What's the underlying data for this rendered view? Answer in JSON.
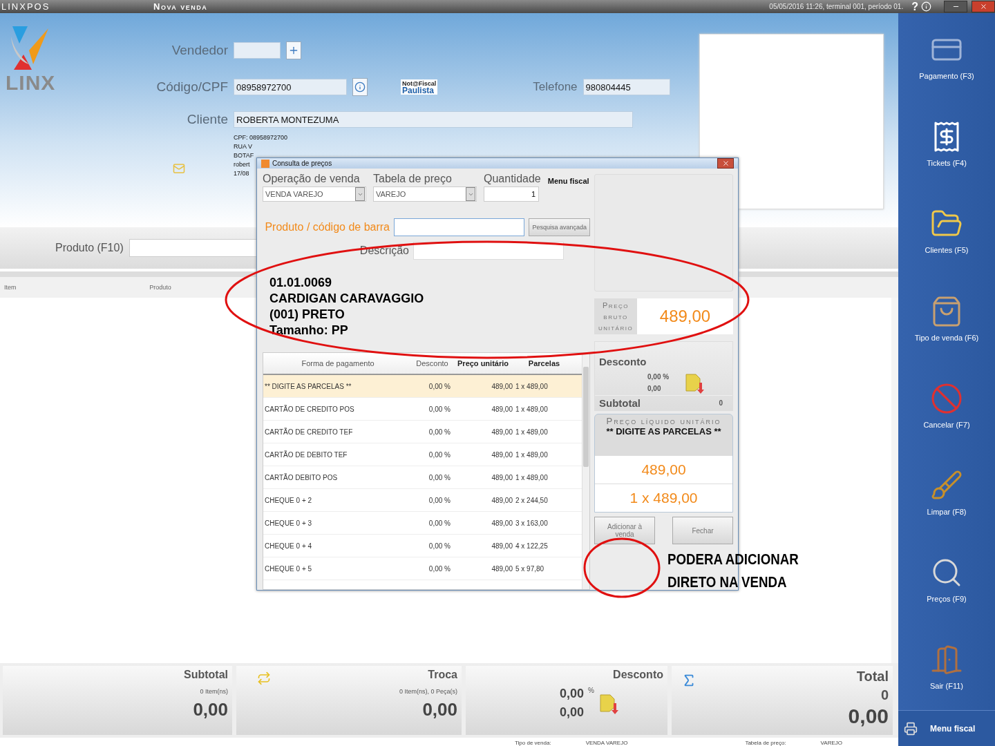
{
  "titlebar": {
    "app": "LINXPOS",
    "title": "Nova venda",
    "status": "05/05/2016 11:26, terminal 001, período 01.",
    "help": "?"
  },
  "logo": {
    "text": "LINX"
  },
  "form": {
    "vendedor": {
      "label": "Vendedor"
    },
    "cpf": {
      "label": "Código/CPF",
      "value": "08958972700"
    },
    "nota_badge": [
      "Not@Fiscal",
      "Paulista"
    ],
    "telefone": {
      "label": "Telefone",
      "value": "980804445"
    },
    "cliente": {
      "label": "Cliente",
      "value": "ROBERTA MONTEZUMA"
    },
    "info_lines": [
      "CPF: 08958972700",
      "RUA V",
      "BOTAF",
      "robert",
      "17/08"
    ]
  },
  "product_bar": {
    "label": "Produto (F10)"
  },
  "item_columns": [
    "Item",
    "Produto"
  ],
  "dialog": {
    "title": "Consulta de preços",
    "operacao": {
      "label": "Operação de venda",
      "value": "VENDA VAREJO"
    },
    "tabela": {
      "label": "Tabela de preço",
      "value": "VAREJO"
    },
    "quantidade": {
      "label": "Quantidade",
      "value": "1"
    },
    "menu_fiscal": "Menu fiscal",
    "produto_label": "Produto / código de barra",
    "search_button": "Pesquisa avançada",
    "descricao_label": "Descrição",
    "product_lines": [
      "01.01.0069",
      "CARDIGAN CARAVAGGIO",
      "(001) PRETO",
      "Tamanho: PP"
    ],
    "price_label": "Preço bruto unitário",
    "price": "489,00",
    "columns": [
      "Forma de pagamento",
      "Desconto",
      "Preço unitário",
      "Parcelas"
    ],
    "rows": [
      {
        "forma": "** DIGITE AS PARCELAS **",
        "desconto": "0,00 %",
        "preco": "489,00",
        "parcelas": "1 x 489,00",
        "selected": true
      },
      {
        "forma": "CARTÃO DE CREDITO POS",
        "desconto": "0,00 %",
        "preco": "489,00",
        "parcelas": "1 x 489,00",
        "selected": false
      },
      {
        "forma": "CARTÃO DE CREDITO TEF",
        "desconto": "0,00 %",
        "preco": "489,00",
        "parcelas": "1 x 489,00",
        "selected": false
      },
      {
        "forma": "CARTÃO DE DEBITO TEF",
        "desconto": "0,00 %",
        "preco": "489,00",
        "parcelas": "1 x 489,00",
        "selected": false
      },
      {
        "forma": "CARTÃO DEBITO POS",
        "desconto": "0,00 %",
        "preco": "489,00",
        "parcelas": "1 x 489,00",
        "selected": false
      },
      {
        "forma": "CHEQUE 0 + 2",
        "desconto": "0,00 %",
        "preco": "489,00",
        "parcelas": "2 x 244,50",
        "selected": false
      },
      {
        "forma": "CHEQUE 0 + 3",
        "desconto": "0,00 %",
        "preco": "489,00",
        "parcelas": "3 x 163,00",
        "selected": false
      },
      {
        "forma": "CHEQUE 0 + 4",
        "desconto": "0,00 %",
        "preco": "489,00",
        "parcelas": "4 x 122,25",
        "selected": false
      },
      {
        "forma": "CHEQUE 0 + 5",
        "desconto": "0,00 %",
        "preco": "489,00",
        "parcelas": "5 x 97,80",
        "selected": false
      }
    ],
    "desconto": {
      "title": "Desconto",
      "percent": "0,00",
      "percent_sign": "%",
      "value": "0,00"
    },
    "subtotal": {
      "label": "Subtotal",
      "value": "0"
    },
    "liquido": {
      "label": "Preço líquido unitário",
      "forma": "** DIGITE AS PARCELAS **",
      "price": "489,00",
      "parcelas": "1 x 489,00"
    },
    "buttons": [
      "Adicionar à venda",
      "Fechar"
    ]
  },
  "annotation": {
    "lines": [
      "PODERA ADICIONAR",
      "DIRETO NA VENDA"
    ]
  },
  "sidebar": {
    "items": [
      "Pagamento (F3)",
      "Tickets (F4)",
      "Clientes (F5)",
      "Tipo de venda (F6)",
      "Cancelar (F7)",
      "Limpar (F8)",
      "Preços (F9)",
      "Sair (F11)"
    ],
    "menu_fiscal": "Menu fiscal"
  },
  "summary": {
    "subtotal": {
      "label": "Subtotal",
      "count": "0 Item(ns)",
      "value": "0,00"
    },
    "troca": {
      "label": "Troca",
      "count": "0 Item(ns), 0 Peça(s)",
      "value": "0,00"
    },
    "desconto": {
      "label": "Desconto",
      "percent": "0,00",
      "percent_sign": "%",
      "value": "0,00"
    },
    "total": {
      "label": "Total",
      "count": "0",
      "value": "0,00"
    }
  },
  "footer": [
    {
      "label": "Tipo de venda:",
      "value": "VENDA VAREJO"
    },
    {
      "label": "Tabela de preço:",
      "value": "VAREJO"
    }
  ]
}
